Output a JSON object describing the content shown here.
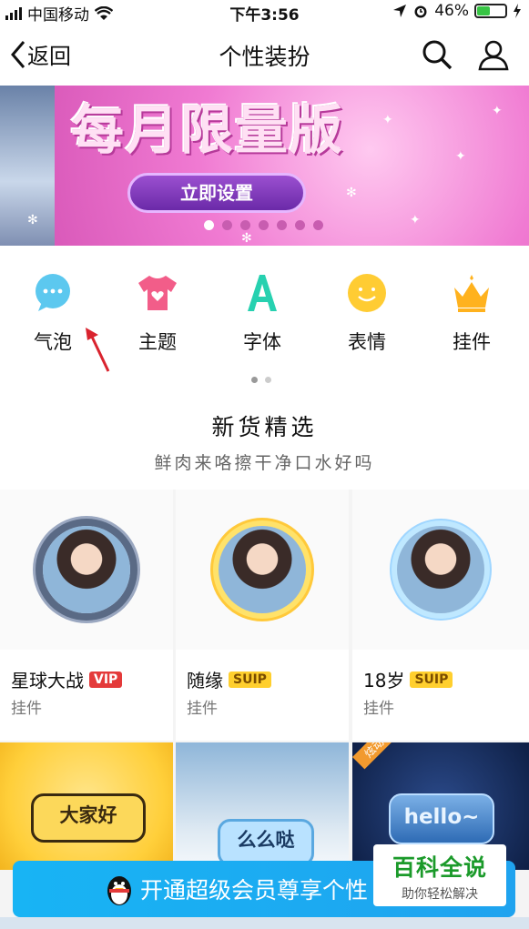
{
  "status_bar": {
    "carrier": "中国移动",
    "time": "下午3:56",
    "battery": "46%",
    "battery_level": 0.46
  },
  "nav": {
    "back_label": "返回",
    "title": "个性装扮"
  },
  "banner": {
    "title": "每月限量版",
    "button_label": "立即设置",
    "slide_count": 7,
    "active_slide": 0
  },
  "categories": [
    {
      "label": "气泡",
      "icon": "chat-bubble-icon",
      "color": "#5cc8ef"
    },
    {
      "label": "主题",
      "icon": "tshirt-icon",
      "color": "#f25d89"
    },
    {
      "label": "字体",
      "icon": "font-a-icon",
      "color": "#27d1b0"
    },
    {
      "label": "表情",
      "icon": "smiley-icon",
      "color": "#ffcc33"
    },
    {
      "label": "挂件",
      "icon": "crown-icon",
      "color": "#ffb21e"
    }
  ],
  "section": {
    "title": "新货精选",
    "subtitle": "鲜肉来咯擦干净口水好吗"
  },
  "products": [
    {
      "name": "星球大战",
      "badge": "VIP",
      "category": "挂件"
    },
    {
      "name": "随缘",
      "badge": "SUIP",
      "category": "挂件"
    },
    {
      "name": "18岁",
      "badge": "SUIP",
      "category": "挂件"
    }
  ],
  "bubbles": [
    {
      "text": "大家好"
    },
    {
      "text": "么么哒"
    },
    {
      "text": "hello~",
      "ribbon": "炫动"
    }
  ],
  "cta": {
    "label": "开通超级会员尊享个性"
  },
  "watermark": {
    "title": "百科全说",
    "subtitle": "助你轻松解决"
  }
}
